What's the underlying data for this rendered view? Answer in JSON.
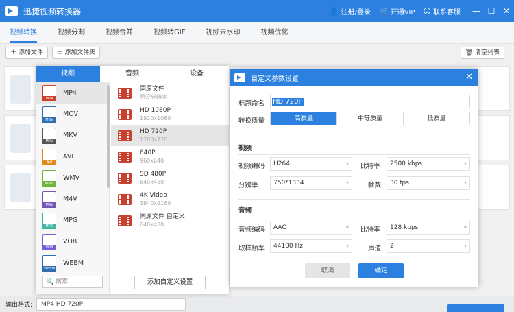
{
  "app": {
    "title": "迅捷视频转换器"
  },
  "titlebar": {
    "login": "注册/登录",
    "vip": "开通VIP",
    "support": "联系客服",
    "icons": {
      "user": "user-icon",
      "vip": "cart-icon",
      "support": "chat-icon"
    }
  },
  "nav": {
    "tabs": [
      "视频转换",
      "视频分割",
      "视频合并",
      "视频转GIF",
      "视频去水印",
      "视频优化"
    ],
    "active": 0
  },
  "toolbar": {
    "add_file": "添加文件",
    "add_folder": "添加文件夹",
    "clear": "清空列表"
  },
  "format_panel": {
    "tabs": [
      "视频",
      "音频",
      "设备"
    ],
    "formats": [
      "MP4",
      "MOV",
      "MKV",
      "AVI",
      "WMV",
      "M4V",
      "MPG",
      "VOB",
      "WEBM"
    ],
    "format_colors": [
      "#c8412e",
      "#2e6fb3",
      "#555555",
      "#e08a1e",
      "#6fb33d",
      "#7057b3",
      "#3eb6a2",
      "#7b5cd6",
      "#2e6fb3"
    ],
    "active_format": "MP4",
    "search_placeholder": "搜索",
    "presets": [
      {
        "name": "同原文件",
        "sub": "原视分辨率"
      },
      {
        "name": "HD 1080P",
        "sub": "1920x1080"
      },
      {
        "name": "HD 720P",
        "sub": "1280x720"
      },
      {
        "name": "640P",
        "sub": "960x640"
      },
      {
        "name": "SD 480P",
        "sub": "640x480"
      },
      {
        "name": "4K Video",
        "sub": "3840x2160"
      },
      {
        "name": "同原文件 自定义",
        "sub": "640x480"
      }
    ],
    "active_preset": 2,
    "add_custom": "添加自定义设置"
  },
  "dialog": {
    "title": "自定义参数设置",
    "name_label": "标题命名",
    "name_value": "HD 720P",
    "quality_label": "转换质量",
    "quality_options": [
      "高质量",
      "中等质量",
      "低质量"
    ],
    "quality_selected": 0,
    "video_section": "视频",
    "video_codec_label": "视频编码",
    "video_codec": "H264",
    "bitrate_label": "比特率",
    "video_bitrate": "2500 kbps",
    "resolution_label": "分辨率",
    "resolution": "750*1334",
    "fps_label": "帧数",
    "fps": "30 fps",
    "audio_section": "音频",
    "audio_codec_label": "音频编码",
    "audio_codec": "AAC",
    "audio_bitrate": "128 kbps",
    "sample_rate_label": "取样频率",
    "sample_rate": "44100 Hz",
    "channel_label": "声道",
    "channel": "2",
    "cancel": "取消",
    "ok": "确定"
  },
  "bottombar": {
    "output_label": "输出格式:",
    "output_value": "MP4  HD 720P"
  }
}
